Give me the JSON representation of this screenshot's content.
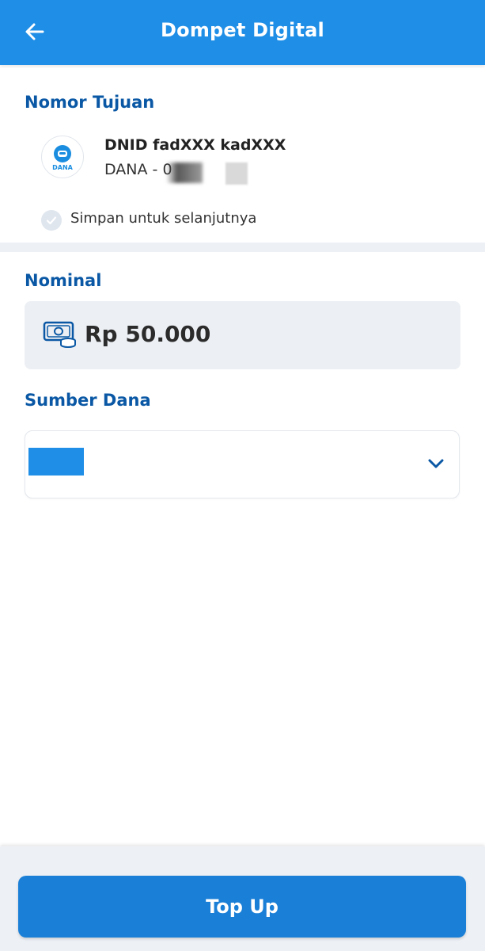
{
  "header": {
    "title": "Dompet Digital"
  },
  "recipient_section": {
    "label": "Nomor Tujuan",
    "provider_logo_text": "DANA",
    "name": "DNID fadXXX kadXXX",
    "account_prefix": "DANA - 0",
    "save_label": "Simpan untuk selanjutnya"
  },
  "amount_section": {
    "label": "Nominal",
    "value": "Rp 50.000"
  },
  "source_section": {
    "label": "Sumber Dana"
  },
  "footer": {
    "button_label": "Top Up"
  },
  "colors": {
    "header": "#1f8ee6",
    "label": "#0a58a5",
    "button": "#1a7fd6",
    "dana_blue": "#1a8de0"
  }
}
